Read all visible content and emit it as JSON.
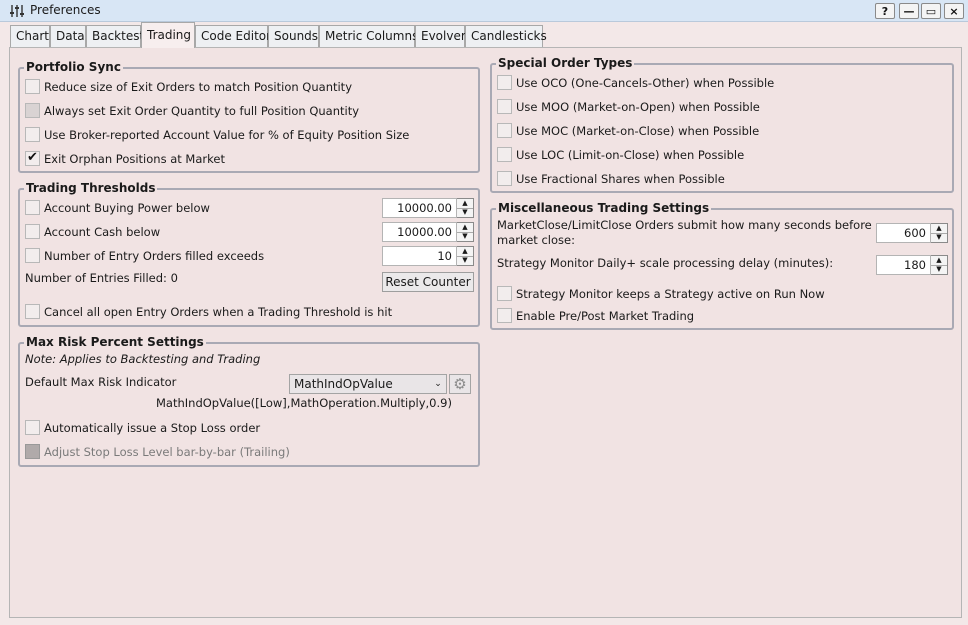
{
  "window": {
    "title": "Preferences",
    "help_label": "?",
    "minimize_label": "—",
    "maximize_label": "▭",
    "close_label": "×"
  },
  "tabs": [
    {
      "label": "Chart"
    },
    {
      "label": "Data"
    },
    {
      "label": "Backtest"
    },
    {
      "label": "Trading",
      "active": true
    },
    {
      "label": "Code Editor"
    },
    {
      "label": "Sounds"
    },
    {
      "label": "Metric Columns"
    },
    {
      "label": "Evolver"
    },
    {
      "label": "Candlesticks"
    }
  ],
  "portfolio_sync": {
    "title": "Portfolio Sync",
    "options": [
      {
        "label": "Reduce size of Exit Orders to match Position Quantity",
        "checked": false
      },
      {
        "label": "Always set Exit Order Quantity to full Position Quantity",
        "checked": false
      },
      {
        "label": "Use Broker-reported Account Value for % of Equity Position Size",
        "checked": false
      },
      {
        "label": "Exit Orphan Positions at Market",
        "checked": true
      }
    ]
  },
  "trading_thresholds": {
    "title": "Trading Thresholds",
    "buying_power": {
      "label": "Account Buying Power below",
      "checked": false,
      "value": "10000.00"
    },
    "cash": {
      "label": "Account Cash below",
      "checked": false,
      "value": "10000.00"
    },
    "entry_orders": {
      "label": "Number of Entry Orders filled exceeds",
      "checked": false,
      "value": "10"
    },
    "entries_filled": "Number of Entries Filled: 0",
    "reset_counter_label": "Reset Counter",
    "cancel_all": {
      "label": "Cancel all open Entry Orders when a Trading Threshold is hit",
      "checked": false
    }
  },
  "max_risk": {
    "title": "Max Risk Percent Settings",
    "note": "Note: Applies to Backtesting and Trading",
    "indicator_label": "Default Max Risk Indicator",
    "indicator_value": "MathIndOpValue",
    "indicator_expression": "MathIndOpValue([Low],MathOperation.Multiply,0.9)",
    "stop_loss": {
      "label": "Automatically issue a Stop Loss order",
      "checked": false
    },
    "adjust_stop": {
      "label": "Adjust Stop Loss Level bar-by-bar (Trailing)",
      "checked": false
    }
  },
  "special_orders": {
    "title": "Special Order Types",
    "options": [
      {
        "label": "Use OCO (One-Cancels-Other) when Possible",
        "checked": false
      },
      {
        "label": "Use MOO (Market-on-Open) when Possible",
        "checked": false
      },
      {
        "label": "Use MOC (Market-on-Close) when Possible",
        "checked": false
      },
      {
        "label": "Use LOC (Limit-on-Close) when Possible",
        "checked": false
      },
      {
        "label": "Use Fractional Shares when Possible",
        "checked": false
      }
    ]
  },
  "misc": {
    "title": "Miscellaneous Trading Settings",
    "close_seconds_label_1": "MarketClose/LimitClose Orders submit how many seconds before",
    "close_seconds_label_2": "market close:",
    "close_seconds_value": "600",
    "monitor_delay_label": "Strategy Monitor Daily+ scale processing delay (minutes):",
    "monitor_delay_value": "180",
    "keep_active": {
      "label": "Strategy Monitor keeps a Strategy active on Run Now",
      "checked": false
    },
    "pre_post": {
      "label": "Enable Pre/Post Market Trading",
      "checked": false
    }
  }
}
